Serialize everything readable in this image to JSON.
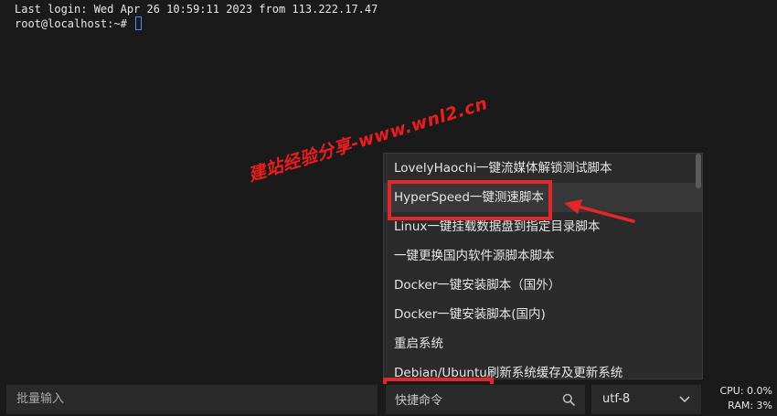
{
  "terminal": {
    "lines": [
      "Last login: Wed Apr 26 10:59:11 2023 from 113.222.17.47",
      "root@localhost:~# "
    ]
  },
  "dropdown": {
    "items": [
      "LovelyHaochi一键流媒体解锁测试脚本",
      "HyperSpeed一键测速脚本",
      "Linux一键挂载数据盘到指定目录脚本",
      "一键更换国内软件源脚本脚本",
      "Docker一键安装脚本（国外）",
      "Docker一键安装脚本(国内)",
      "重启系统",
      "Debian/Ubuntu刷新系统缓存及更新系统"
    ]
  },
  "watermark": {
    "text": "建站经验分享-www.wnl2.cn"
  },
  "bottom": {
    "batch_input": "批量输入",
    "quick_command_placeholder": "快捷命令",
    "encoding": "utf-8",
    "cpu": "CPU: 0.0%",
    "ram": "RAM: 3%"
  },
  "colors": {
    "accent_red": "#e5262a",
    "background": "#1a1a1a",
    "cursor": "#4a8cff"
  },
  "icons": {
    "search": "search-icon",
    "chevron": "chevron-down-icon"
  }
}
